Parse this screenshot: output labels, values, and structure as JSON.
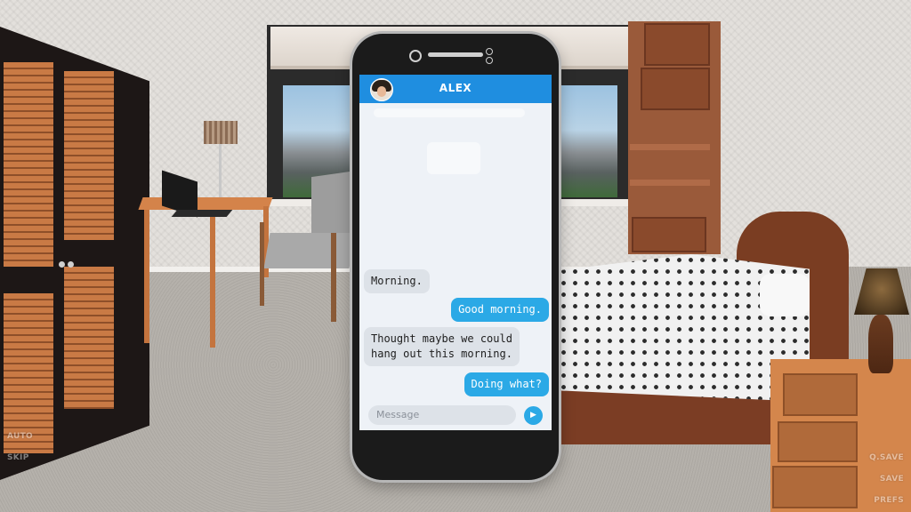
{
  "phone": {
    "contact_name": "ALEX",
    "messages": [
      {
        "from": "them",
        "text": "Morning."
      },
      {
        "from": "me",
        "text": "Good morning."
      },
      {
        "from": "them",
        "text": "Thought maybe we could\nhang out this morning."
      },
      {
        "from": "me",
        "text": "Doing what?"
      }
    ],
    "input_placeholder": "Message",
    "send_icon": "▶"
  },
  "menu": {
    "left": [
      "AUTO",
      "SKIP"
    ],
    "right": [
      "Q.SAVE",
      "SAVE",
      "PREFS"
    ]
  },
  "colors": {
    "header": "#1f8ee0",
    "outgoing_bubble": "#2ba9e6",
    "incoming_bubble": "#dde2e8"
  }
}
